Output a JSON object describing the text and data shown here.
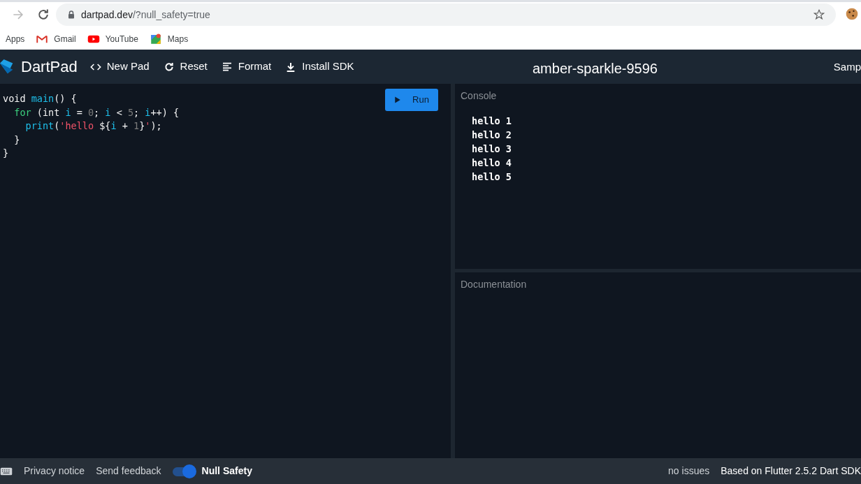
{
  "browser": {
    "url_host": "dartpad.dev",
    "url_path": "/?null_safety=true",
    "bookmarks": [
      {
        "label": "Apps"
      },
      {
        "label": "Gmail"
      },
      {
        "label": "YouTube"
      },
      {
        "label": "Maps"
      }
    ]
  },
  "app_bar": {
    "brand": "DartPad",
    "actions": [
      {
        "label": "New Pad"
      },
      {
        "label": "Reset"
      },
      {
        "label": "Format"
      },
      {
        "label": "Install SDK"
      }
    ],
    "title": "amber-sparkle-9596",
    "samples": "Samp"
  },
  "editor": {
    "run_button": "Run",
    "lines": [
      [
        {
          "text": "void ",
          "kind": "keyword"
        },
        {
          "text": "main",
          "kind": "ident"
        },
        {
          "text": "() {",
          "kind": "plain"
        }
      ],
      [
        {
          "text": "  for",
          "kind": "control"
        },
        {
          "text": " (int ",
          "kind": "plain"
        },
        {
          "text": "i",
          "kind": "ident"
        },
        {
          "text": " = ",
          "kind": "plain"
        },
        {
          "text": "0",
          "kind": "number"
        },
        {
          "text": "; ",
          "kind": "plain"
        },
        {
          "text": "i",
          "kind": "ident"
        },
        {
          "text": " < ",
          "kind": "plain"
        },
        {
          "text": "5",
          "kind": "number"
        },
        {
          "text": "; ",
          "kind": "plain"
        },
        {
          "text": "i",
          "kind": "ident"
        },
        {
          "text": "++) {",
          "kind": "plain"
        }
      ],
      [
        {
          "text": "    print",
          "kind": "ident"
        },
        {
          "text": "(",
          "kind": "plain"
        },
        {
          "text": "'hello ",
          "kind": "string"
        },
        {
          "text": "${",
          "kind": "plain"
        },
        {
          "text": "i",
          "kind": "ident"
        },
        {
          "text": " + ",
          "kind": "plain"
        },
        {
          "text": "1",
          "kind": "number"
        },
        {
          "text": "}",
          "kind": "plain"
        },
        {
          "text": "'",
          "kind": "string"
        },
        {
          "text": ");",
          "kind": "plain"
        }
      ],
      [
        {
          "text": "  }",
          "kind": "plain"
        }
      ],
      [
        {
          "text": "}",
          "kind": "plain"
        }
      ]
    ]
  },
  "console": {
    "title": "Console",
    "output": [
      "hello 1",
      "hello 2",
      "hello 3",
      "hello 4",
      "hello 5"
    ]
  },
  "documentation": {
    "title": "Documentation"
  },
  "footer": {
    "links": [
      "Privacy notice",
      "Send feedback"
    ],
    "null_safety": {
      "label": "Null Safety",
      "on": true
    },
    "issues": "no issues",
    "version": "Based on Flutter 2.5.2 Dart SDK"
  }
}
